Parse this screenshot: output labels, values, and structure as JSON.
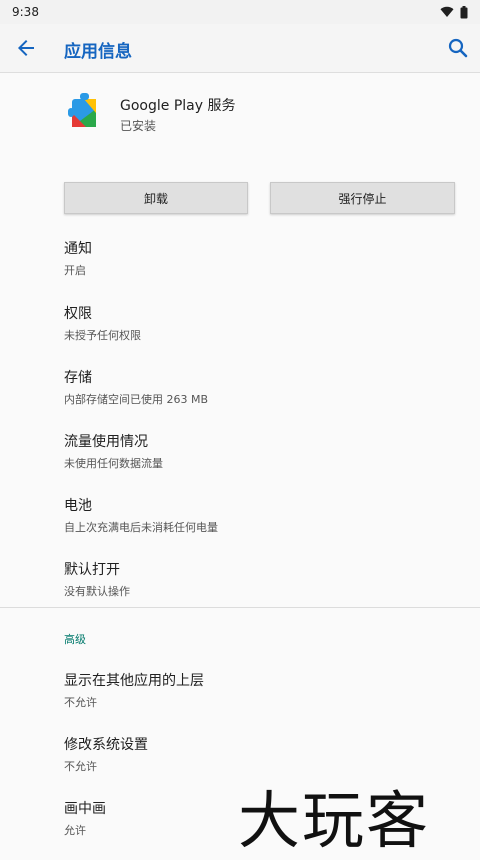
{
  "status_bar": {
    "time": "9:38"
  },
  "app_bar": {
    "title": "应用信息"
  },
  "app": {
    "name": "Google Play 服务",
    "status": "已安装"
  },
  "buttons": {
    "uninstall": "卸载",
    "force_stop": "强行停止"
  },
  "settings": [
    {
      "title": "通知",
      "subtitle": "开启"
    },
    {
      "title": "权限",
      "subtitle": "未授予任何权限"
    },
    {
      "title": "存储",
      "subtitle": "内部存储空间已使用 263 MB"
    },
    {
      "title": "流量使用情况",
      "subtitle": "未使用任何数据流量"
    },
    {
      "title": "电池",
      "subtitle": "自上次充满电后未消耗任何电量"
    },
    {
      "title": "默认打开",
      "subtitle": "没有默认操作"
    }
  ],
  "advanced": {
    "header": "高级",
    "items": [
      {
        "title": "显示在其他应用的上层",
        "subtitle": "不允许"
      },
      {
        "title": "修改系统设置",
        "subtitle": "不允许"
      },
      {
        "title": "画中画",
        "subtitle": "允许"
      }
    ]
  },
  "watermark": "大玩客",
  "colors": {
    "accent": "#1565c0",
    "section_header": "#00796b"
  }
}
